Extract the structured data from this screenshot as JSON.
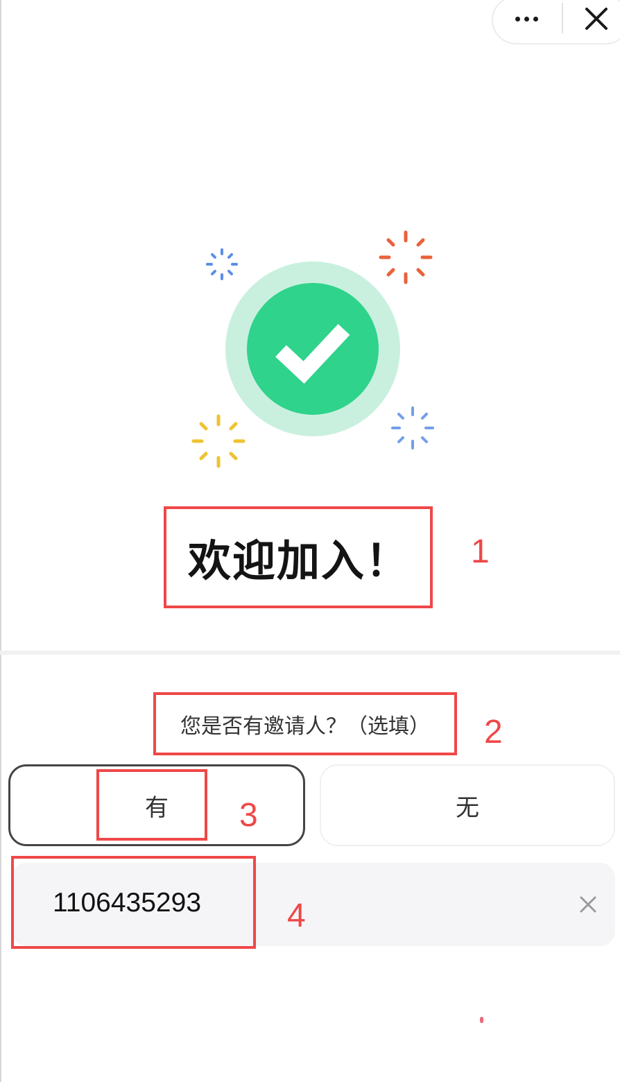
{
  "window": {
    "more_icon": "more-dots-icon",
    "close_icon": "close-icon"
  },
  "hero": {
    "icon": "success-checkmark-icon",
    "colors": {
      "halo": "#c9f0df",
      "circle": "#2fd38b",
      "sparkle_blue": "#5b8ee8",
      "sparkle_orange": "#e8623c",
      "sparkle_yellow": "#efc332"
    }
  },
  "welcome": {
    "title": "欢迎加入！"
  },
  "inviter": {
    "question": "您是否有邀请人？（选填）",
    "options": [
      {
        "label": "有",
        "selected": true
      },
      {
        "label": "无",
        "selected": false
      }
    ],
    "input_value": "1106435293",
    "clear_icon": "clear-x-icon"
  },
  "annotations": [
    "1",
    "2",
    "3",
    "4"
  ],
  "accent_color": "#ef4848"
}
